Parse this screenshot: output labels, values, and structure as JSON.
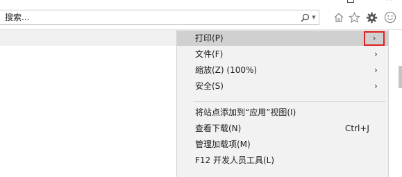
{
  "search": {
    "placeholder": "搜索...",
    "value": ""
  },
  "toolbar": {
    "icons": [
      "search-icon",
      "home-icon",
      "favorites-star-icon",
      "tools-gear-icon",
      "feedback-smile-icon"
    ]
  },
  "menu": {
    "items": [
      {
        "label": "打印(P)",
        "submenu": true,
        "shortcut": ""
      },
      {
        "label": "文件(F)",
        "submenu": true,
        "shortcut": ""
      },
      {
        "label": "缩放(Z) (100%)",
        "submenu": true,
        "shortcut": ""
      },
      {
        "label": "安全(S)",
        "submenu": true,
        "shortcut": ""
      },
      {
        "label": "将站点添加到“应用”视图(I)",
        "submenu": false,
        "shortcut": ""
      },
      {
        "label": "查看下载(N)",
        "submenu": false,
        "shortcut": "Ctrl+J"
      },
      {
        "label": "管理加载项(M)",
        "submenu": false,
        "shortcut": ""
      },
      {
        "label": "F12 开发人员工具(L)",
        "submenu": false,
        "shortcut": ""
      }
    ],
    "chevron": "›"
  },
  "colors": {
    "highlight": "#d0d0d0",
    "annotation_box": "#e02020",
    "menu_bg": "#f2f2f2"
  }
}
